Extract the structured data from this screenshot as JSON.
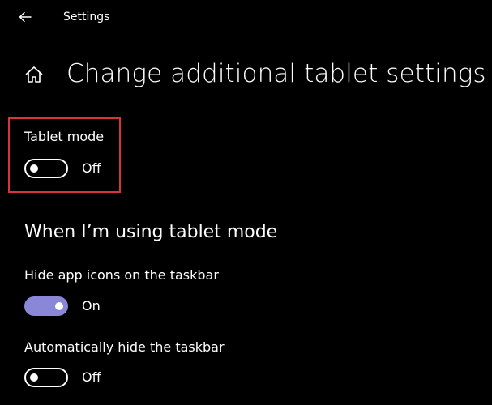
{
  "window": {
    "title": "Settings"
  },
  "page": {
    "title": "Change additional tablet settings"
  },
  "tablet_mode": {
    "label": "Tablet mode",
    "state": "Off"
  },
  "section": {
    "title": "When I’m using tablet mode"
  },
  "hide_app_icons": {
    "label": "Hide app icons on the taskbar",
    "state": "On"
  },
  "auto_hide_taskbar": {
    "label": "Automatically hide the taskbar",
    "state": "Off"
  },
  "colors": {
    "background": "#000000",
    "text": "#ffffff",
    "accent": "#8a86d8",
    "highlight": "#d8343a"
  },
  "icons": {
    "back": "back-arrow-icon",
    "home": "home-icon"
  }
}
